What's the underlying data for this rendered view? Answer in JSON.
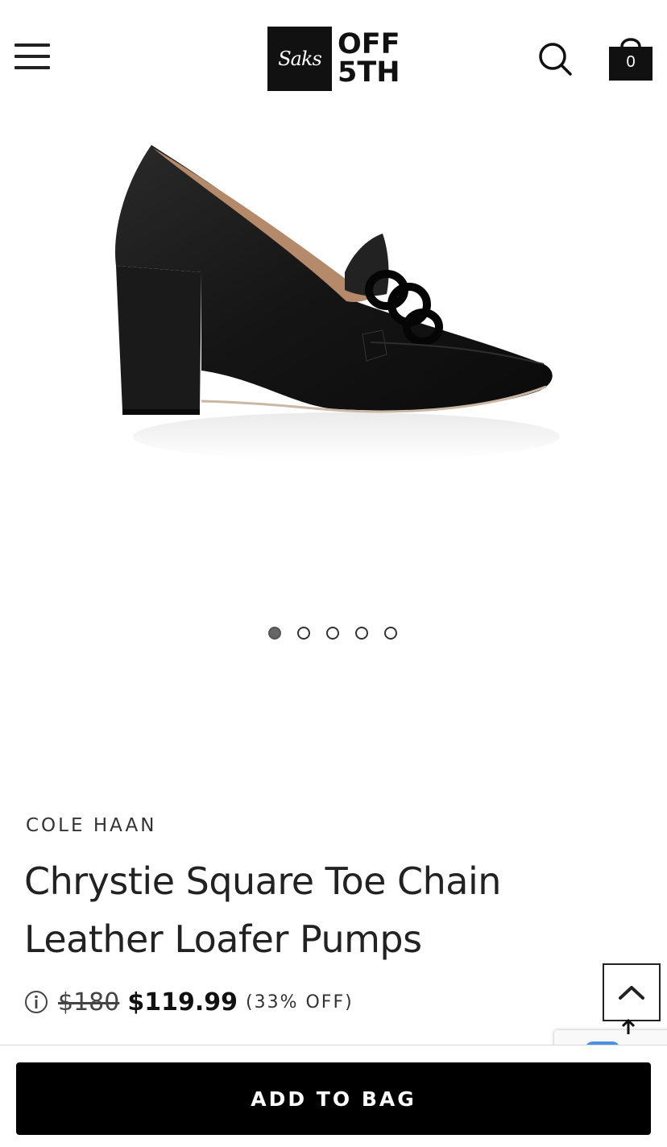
{
  "header": {
    "logo_script": "Saks",
    "logo_line1": "OFF",
    "logo_line2": "5TH",
    "bag_count": "0"
  },
  "carousel": {
    "total": 5,
    "active_index": 0
  },
  "product": {
    "brand": "COLE HAAN",
    "title": "Chrystie Square Toe Chain Leather Loafer Pumps",
    "original_price": "$180",
    "sale_price": "$119.99",
    "discount": "(33% OFF)"
  },
  "actions": {
    "add_to_bag_label": "ADD TO BAG"
  },
  "icons": [
    "menu-icon",
    "search-icon",
    "bag-icon",
    "info-icon",
    "chevron-up-icon"
  ],
  "colors": {
    "primary": "#000000",
    "text": "#222222",
    "background": "#ffffff"
  }
}
